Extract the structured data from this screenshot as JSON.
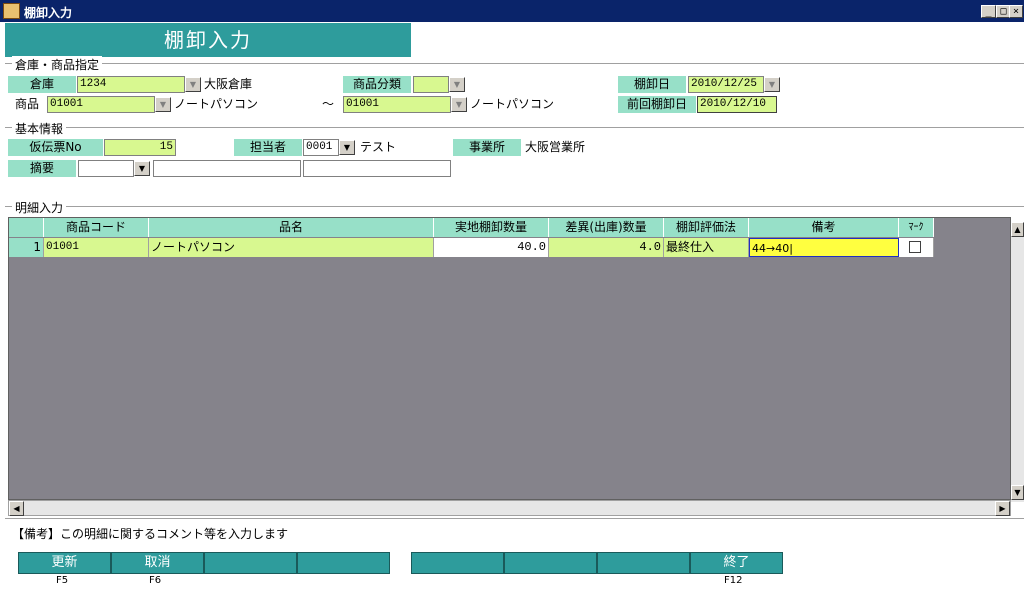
{
  "window": {
    "title": "棚卸入力"
  },
  "banner": {
    "title": "棚卸入力"
  },
  "groups": {
    "warehouse": "倉庫・商品指定",
    "basic": "基本情報",
    "detail": "明細入力"
  },
  "warehouse": {
    "label": "倉庫",
    "code": "1234",
    "name": "大阪倉庫"
  },
  "category": {
    "label": "商品分類",
    "value": ""
  },
  "inventory_date": {
    "label": "棚卸日",
    "value": "2010/12/25"
  },
  "product": {
    "label": "商品",
    "from_code": "01001",
    "from_name": "ノートパソコン",
    "tilde": "～",
    "to_code": "01001",
    "to_name": "ノートパソコン"
  },
  "prev_date": {
    "label": "前回棚卸日",
    "value": "2010/12/10"
  },
  "slip": {
    "label": "仮伝票No",
    "value": "15"
  },
  "staff": {
    "label": "担当者",
    "code": "0001",
    "name": "テスト"
  },
  "office": {
    "label": "事業所",
    "value": "大阪営業所"
  },
  "summary": {
    "label": "摘要",
    "value1": "",
    "value2": ""
  },
  "grid": {
    "headers": [
      "商品コード",
      "品名",
      "実地棚卸数量",
      "差異(出庫)数量",
      "棚卸評価法",
      "備考",
      "ﾏｰｸ"
    ],
    "rows": [
      {
        "no": "1",
        "code": "01001",
        "name": "ノートパソコン",
        "actual_qty": "40.0",
        "diff_qty": "4.0",
        "method": "最終仕入",
        "note": "44→40|"
      }
    ]
  },
  "status": "【備考】この明細に関するコメント等を入力します",
  "fkeys": [
    {
      "label": "更新",
      "key": "F5"
    },
    {
      "label": "取消",
      "key": "F6"
    },
    {
      "label": "",
      "key": ""
    },
    {
      "label": "",
      "key": ""
    },
    {
      "label": "",
      "key": ""
    },
    {
      "label": "",
      "key": ""
    },
    {
      "label": "",
      "key": ""
    },
    {
      "label": "終了",
      "key": "F12"
    }
  ]
}
